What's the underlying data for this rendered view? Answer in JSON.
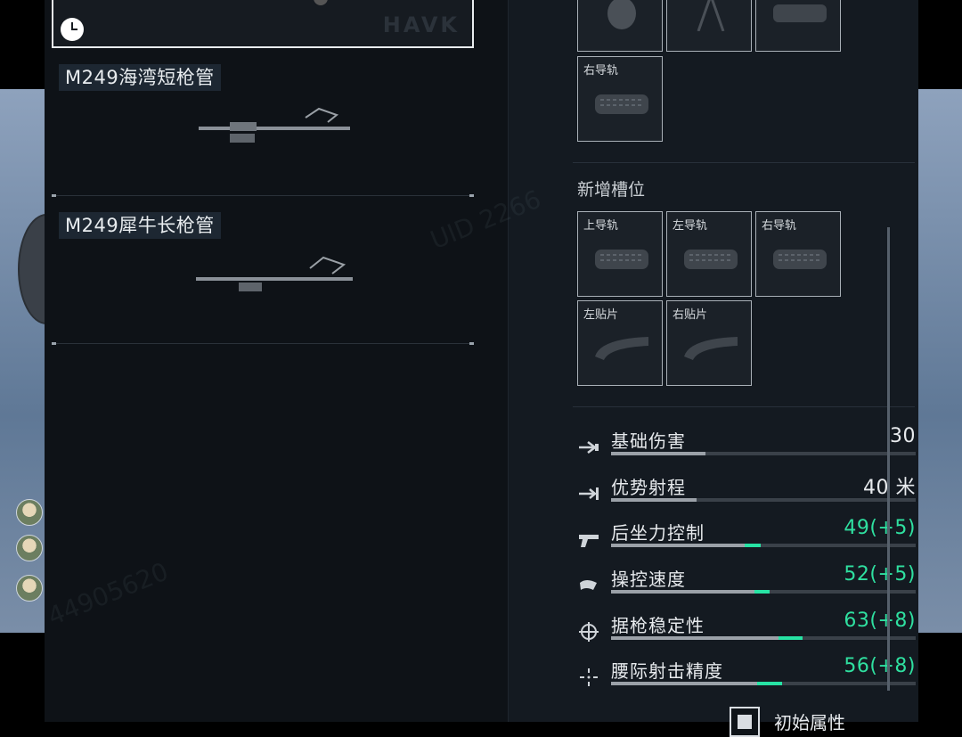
{
  "left_panel": {
    "weapons": [
      {
        "name": "M249海湾短枪管"
      },
      {
        "name": "M249犀牛长枪管"
      }
    ],
    "selected_card": {
      "brand_text": "HAVK"
    }
  },
  "right_panel": {
    "top_slots": [
      {
        "label": ""
      },
      {
        "label": ""
      },
      {
        "label": ""
      }
    ],
    "right_rail_slot": {
      "label": "右导轨"
    },
    "new_slots_title": "新增槽位",
    "new_slots": [
      {
        "label": "上导轨",
        "icon": "rail-icon"
      },
      {
        "label": "左导轨",
        "icon": "rail-icon"
      },
      {
        "label": "右导轨",
        "icon": "rail-icon"
      },
      {
        "label": "左贴片",
        "icon": "pad-icon"
      },
      {
        "label": "右贴片",
        "icon": "pad-icon"
      }
    ],
    "stats": [
      {
        "label": "基础伤害",
        "value": "30",
        "fill": 0.31,
        "bonus": 0,
        "buff": false,
        "icon": "damage-icon"
      },
      {
        "label": "优势射程",
        "value": "40 米",
        "fill": 0.28,
        "bonus": 0,
        "buff": false,
        "icon": "range-icon"
      },
      {
        "label": "后坐力控制",
        "value": "49(+5)",
        "fill": 0.44,
        "bonus": 0.05,
        "buff": true,
        "icon": "recoil-icon"
      },
      {
        "label": "操控速度",
        "value": "52(+5)",
        "fill": 0.47,
        "bonus": 0.05,
        "buff": true,
        "icon": "handling-icon"
      },
      {
        "label": "据枪稳定性",
        "value": "63(+8)",
        "fill": 0.55,
        "bonus": 0.08,
        "buff": true,
        "icon": "stability-icon"
      },
      {
        "label": "腰际射击精度",
        "value": "56(+8)",
        "fill": 0.48,
        "bonus": 0.08,
        "buff": true,
        "icon": "hipfire-icon"
      }
    ],
    "initial_attributes_label": "初始属性"
  },
  "colors": {
    "buff": "#2fe0a0",
    "panel": "#141a21",
    "accent_bar": "#27e3a4"
  }
}
